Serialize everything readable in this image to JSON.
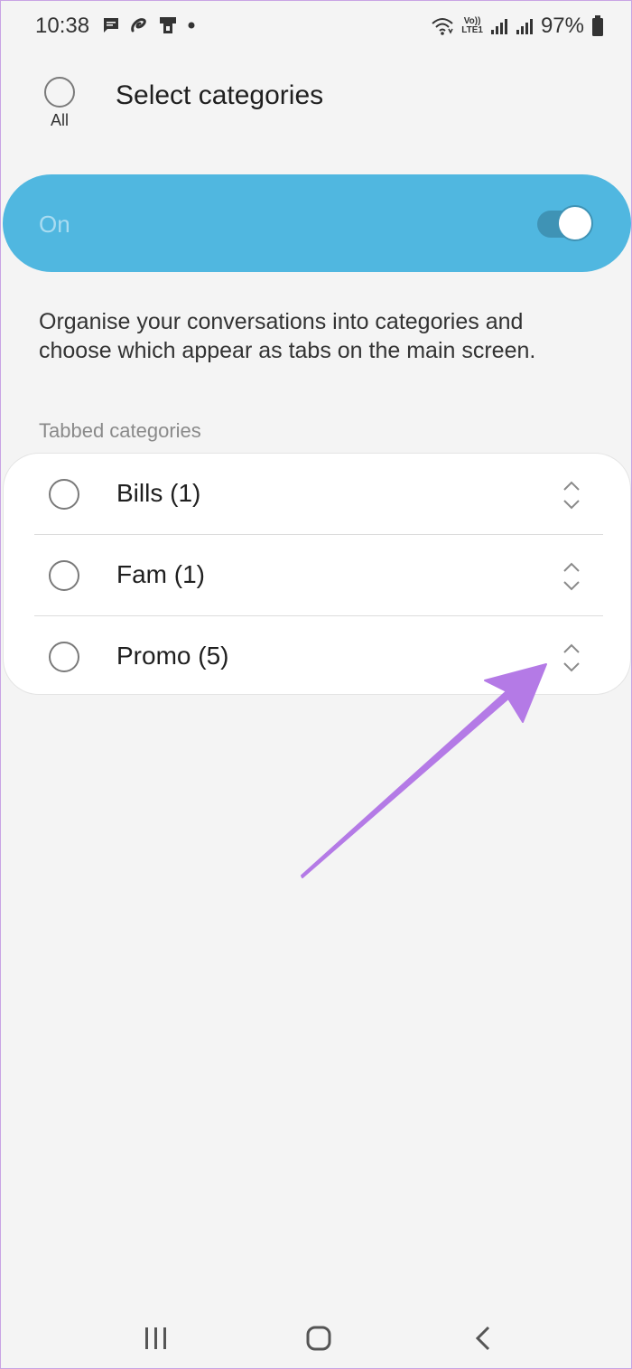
{
  "status_bar": {
    "time": "10:38",
    "battery_percent": "97%",
    "left_icons": [
      "message-icon",
      "airtel-icon",
      "phone-icon",
      "dot-icon"
    ],
    "right_icons": [
      "wifi-icon",
      "volte-icon",
      "signal-icon",
      "signal-icon",
      "battery-icon"
    ],
    "volte_line1": "Vo))",
    "volte_line2": "LTE1"
  },
  "header": {
    "select_all_label": "All",
    "title": "Select categories"
  },
  "master_toggle": {
    "label": "On",
    "checked": true,
    "accent_color": "#50b7e0"
  },
  "description": "Organise your conversations into categories and choose which appear as tabs on the main screen.",
  "section_label": "Tabbed categories",
  "categories": [
    {
      "label": "Bills (1)"
    },
    {
      "label": "Fam (1)"
    },
    {
      "label": "Promo (5)"
    }
  ],
  "annotation": {
    "color": "#b47ae6",
    "icon": "arrow-annotation"
  },
  "nav_bar": {
    "icons": [
      "recent-apps-icon",
      "home-icon",
      "back-icon"
    ]
  }
}
